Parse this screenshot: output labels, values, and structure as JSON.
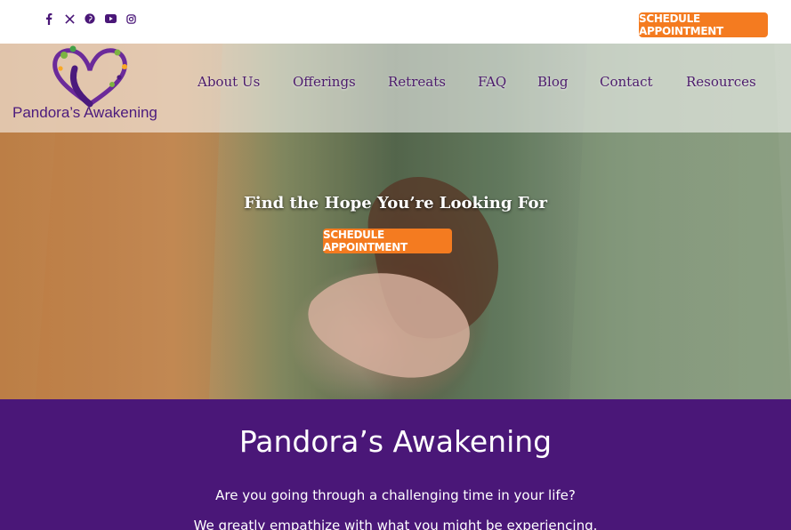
{
  "social": {
    "icons": [
      "facebook-icon",
      "x-twitter-icon",
      "pinterest-icon",
      "youtube-icon",
      "instagram-icon"
    ]
  },
  "header": {
    "cta_label": "Schedule Appointment",
    "logo_text": "Pandora’s Awakening"
  },
  "nav": {
    "items": [
      {
        "label": "About Us"
      },
      {
        "label": "Offerings"
      },
      {
        "label": "Retreats"
      },
      {
        "label": "FAQ"
      },
      {
        "label": "Blog"
      },
      {
        "label": "Contact"
      },
      {
        "label": "Resources"
      }
    ]
  },
  "hero": {
    "title": "Find the Hope You’re Looking For",
    "cta_label": "Schedule Appointment"
  },
  "intro": {
    "heading": "Pandora’s Awakening",
    "line1": "Are you going through a challenging time in your life?",
    "line2": "We greatly empathize with what you might be experiencing."
  },
  "colors": {
    "accent": "#f47b20",
    "brand_purple": "#4a1778",
    "nav_text": "#4b1a6b"
  }
}
